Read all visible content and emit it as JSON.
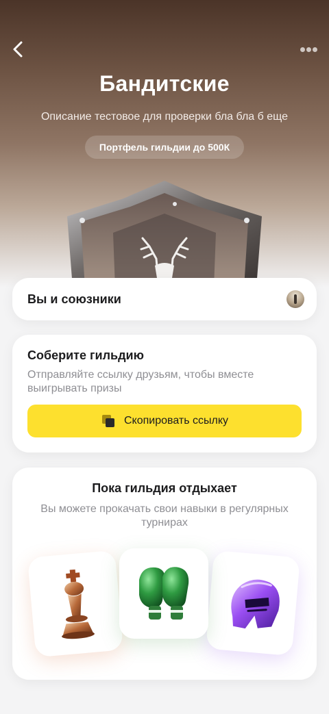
{
  "header": {
    "back_icon": "chevron-left-icon",
    "more_icon": "more-dots-icon",
    "title": "Бандитские",
    "description": "Описание тестовое для проверки бла бла б  еще",
    "portfolio": "Портфель гильдии до 500К",
    "emblem_icon": "deer-shield-emblem"
  },
  "allies": {
    "label": "Вы и союзники",
    "avatar_icon": "user-avatar"
  },
  "gather": {
    "title": "Соберите гильдию",
    "text": "Отправляйте ссылку друзьям, чтобы вместе выигрывать призы",
    "button_label": "Скопировать ссылку",
    "button_icon": "copy-icon",
    "accent": "#fde02e"
  },
  "resting": {
    "title": "Пока гильдия отдыхает",
    "text": "Вы можете прокачать свои навыки в регулярных турнирах",
    "tournaments": [
      {
        "icon": "chess-king-icon",
        "glow": "#e58a55"
      },
      {
        "icon": "boxing-gloves-icon",
        "glow": "#3fa34d"
      },
      {
        "icon": "knight-helmet-icon",
        "glow": "#9b5cf0"
      }
    ]
  }
}
